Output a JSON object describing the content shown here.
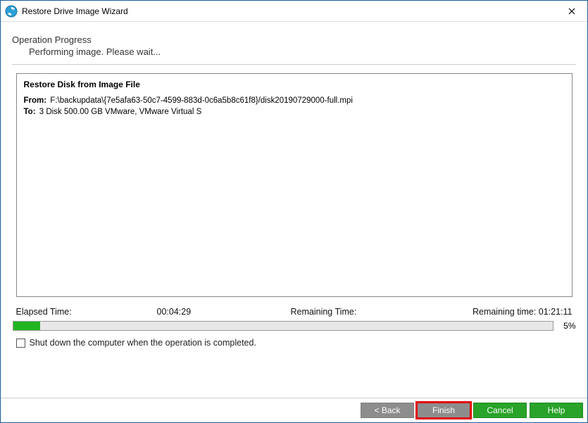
{
  "window": {
    "title": "Restore Drive Image Wizard"
  },
  "header": {
    "title": "Operation Progress",
    "subtitle": "Performing image. Please wait..."
  },
  "panel": {
    "title": "Restore Disk from Image File",
    "from_label": "From:",
    "from_value": "F:\\backupdata\\{7e5afa63-50c7-4599-883d-0c6a5b8c61f8}/disk20190729000-full.mpi",
    "to_label": "To:",
    "to_value": "3 Disk 500.00 GB VMware, VMware Virtual S"
  },
  "times": {
    "elapsed_label": "Elapsed Time:",
    "elapsed_value": "00:04:29",
    "remaining_label": "Remaining Time:",
    "remaining_value": "Remaining time: 01:21:11"
  },
  "progress": {
    "percent": 5,
    "percent_label": "5%"
  },
  "checkbox": {
    "label": "Shut down the computer when the operation is completed.",
    "checked": false
  },
  "buttons": {
    "back": "< Back",
    "finish": "Finish",
    "cancel": "Cancel",
    "help": "Help"
  }
}
